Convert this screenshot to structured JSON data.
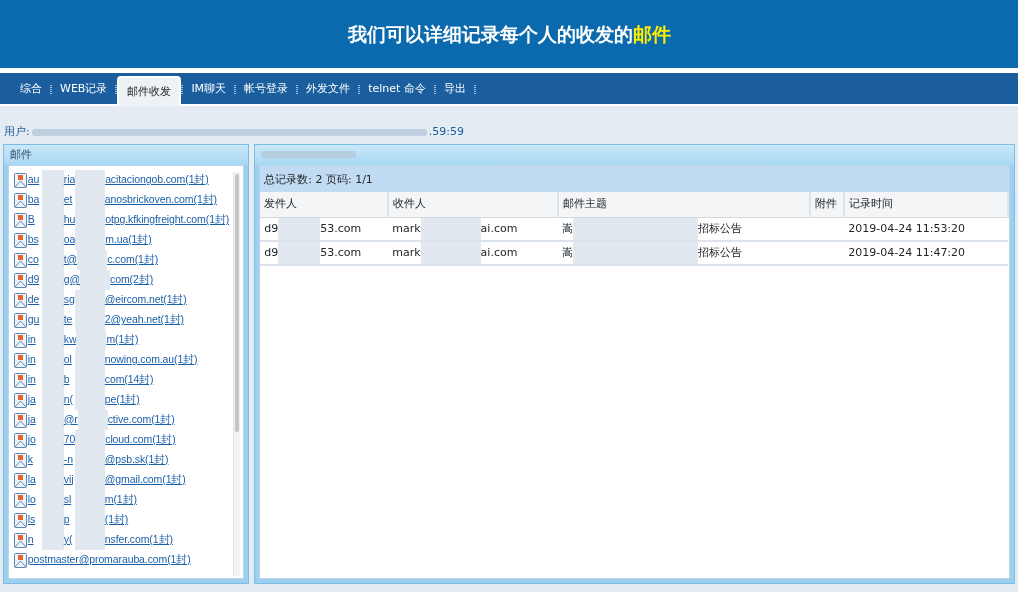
{
  "banner": {
    "title": "我们可以详细记录每个人的收发的",
    "title_highlight": "邮件"
  },
  "tabs": [
    {
      "label": "综合",
      "selected": false
    },
    {
      "label": "WEB记录",
      "selected": false
    },
    {
      "label": "邮件收发",
      "selected": true
    },
    {
      "label": "IM聊天",
      "selected": false
    },
    {
      "label": "帐号登录",
      "selected": false
    },
    {
      "label": "外发文件",
      "selected": false
    },
    {
      "label": "telnet 命令",
      "selected": false
    },
    {
      "label": "导出",
      "selected": false
    }
  ],
  "filter_line": {
    "label": "用户:",
    "tail": ".59:59"
  },
  "mail_panel": {
    "title": "邮件",
    "items": [
      {
        "parts": [
          "au",
          "ria",
          "acitaciongob.com(1封)"
        ]
      },
      {
        "parts": [
          "ba",
          "et",
          "anosbrickoven.com(1封)"
        ]
      },
      {
        "parts": [
          "B",
          "hu",
          "otpg.kfkingfreight.com(1封)"
        ]
      },
      {
        "parts": [
          "bs",
          "oa",
          "m.ua(1封)"
        ]
      },
      {
        "parts": [
          "co",
          "t@",
          "c.com(1封)"
        ]
      },
      {
        "parts": [
          "d9",
          "g@",
          "com(2封)"
        ]
      },
      {
        "parts": [
          "de",
          "sg",
          "@eircom.net(1封)"
        ]
      },
      {
        "parts": [
          "gu",
          "te",
          "2@yeah.net(1封)"
        ]
      },
      {
        "parts": [
          "in",
          "kw",
          "m(1封)"
        ]
      },
      {
        "parts": [
          "in",
          "ol",
          "nowing.com.au(1封)"
        ]
      },
      {
        "parts": [
          "in",
          "b",
          "com(14封)"
        ]
      },
      {
        "parts": [
          "ja",
          "n(",
          "pe(1封)"
        ]
      },
      {
        "parts": [
          "ja",
          "@r",
          "ctive.com(1封)"
        ]
      },
      {
        "parts": [
          "jo",
          "70",
          "cloud.com(1封)"
        ]
      },
      {
        "parts": [
          "k",
          "-n",
          "@psb.sk(1封)"
        ]
      },
      {
        "parts": [
          "la",
          "vij",
          "@gmail.com(1封)"
        ]
      },
      {
        "parts": [
          "lo",
          "sl",
          "m(1封)"
        ]
      },
      {
        "parts": [
          "ls",
          "p",
          "(1封)"
        ]
      },
      {
        "parts": [
          "n",
          "y(",
          "nsfer.com(1封)"
        ]
      },
      {
        "parts": [
          "postmaster@promarauba.com(1封)"
        ]
      }
    ]
  },
  "records": {
    "summary": "总记录数: 2 页码: 1/1",
    "columns": [
      "发件人",
      "收件人",
      "邮件主题",
      "附件",
      "记录时间"
    ],
    "rows": [
      {
        "sender": [
          "d9",
          "53.com"
        ],
        "recipient": [
          "mark",
          "ai.com"
        ],
        "subject": [
          "嵩",
          "招标公告"
        ],
        "time": "2019-04-24 11:53:20"
      },
      {
        "sender": [
          "d9",
          "53.com"
        ],
        "recipient": [
          "mark",
          "ai.com"
        ],
        "subject": [
          "嵩",
          "招标公告"
        ],
        "time": "2019-04-24 11:47:20"
      }
    ]
  }
}
